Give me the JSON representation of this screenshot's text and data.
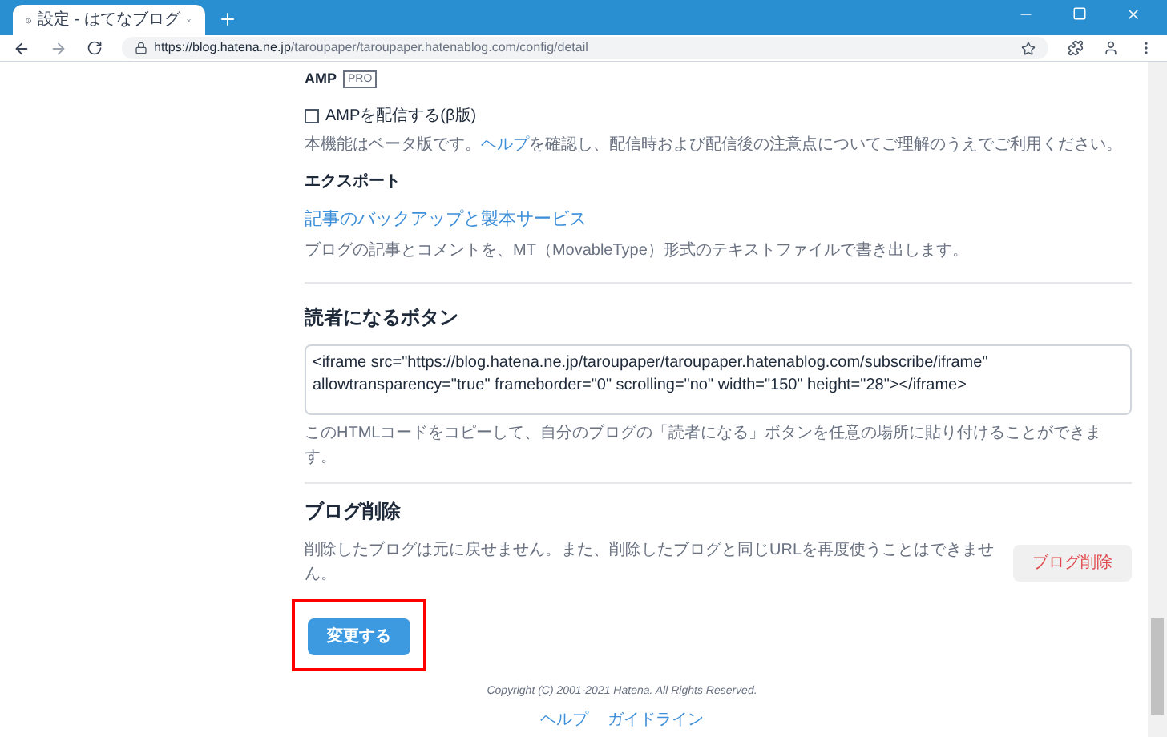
{
  "browser": {
    "tab_title": "設定 - はてなブログ",
    "url_host": "https://blog.hatena.ne.jp",
    "url_path": "/taroupaper/taroupaper.hatenablog.com/config/detail"
  },
  "amp": {
    "heading": "AMP",
    "badge": "PRO",
    "checkbox": {
      "label": "AMPを配信する(β版)",
      "checked": false
    },
    "description": {
      "before": "本機能はベータ版です。",
      "link": "ヘルプ",
      "after": "を確認し、配信時および配信後の注意点についてご理解のうえでご利用ください。"
    }
  },
  "export": {
    "heading": "エクスポート",
    "link": "記事のバックアップと製本サービス",
    "description": "ブログの記事とコメントを、MT（MovableType）形式のテキストファイルで書き出します。"
  },
  "subscribe_button": {
    "heading": "読者になるボタン",
    "code": "<iframe src=\"https://blog.hatena.ne.jp/taroupaper/taroupaper.hatenablog.com/subscribe/iframe\" allowtransparency=\"true\" frameborder=\"0\" scrolling=\"no\" width=\"150\" height=\"28\"></iframe>",
    "description": "このHTMLコードをコピーして、自分のブログの「読者になる」ボタンを任意の場所に貼り付けることができます。"
  },
  "blog_delete": {
    "heading": "ブログ削除",
    "description": "削除したブログは元に戻せません。また、削除したブログと同じURLを再度使うことはできません。",
    "button": "ブログ削除"
  },
  "submit_button": "変更する",
  "footer": {
    "copyright": "Copyright (C) 2001-2021 Hatena. All Rights Reserved.",
    "links": [
      "ヘルプ",
      "ガイドライン"
    ]
  }
}
